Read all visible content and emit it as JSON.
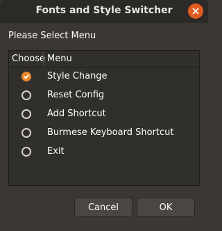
{
  "window": {
    "title": "Fonts and Style Switcher",
    "close_icon": "close-icon"
  },
  "prompt": "Please Select Menu",
  "list": {
    "columns": [
      "Choose",
      "Menu"
    ],
    "items": [
      {
        "label": "Style Change",
        "checked": true
      },
      {
        "label": "Reset Config",
        "checked": false
      },
      {
        "label": "Add Shortcut",
        "checked": false
      },
      {
        "label": "Burmese Keyboard Shortcut",
        "checked": false
      },
      {
        "label": "Exit",
        "checked": false
      }
    ]
  },
  "buttons": {
    "cancel_label": "Cancel",
    "ok_label": "OK"
  },
  "colors": {
    "accent": "#e9892b",
    "close": "#e15a1f",
    "background": "#3b3833",
    "titlebar": "#2c2a26"
  }
}
